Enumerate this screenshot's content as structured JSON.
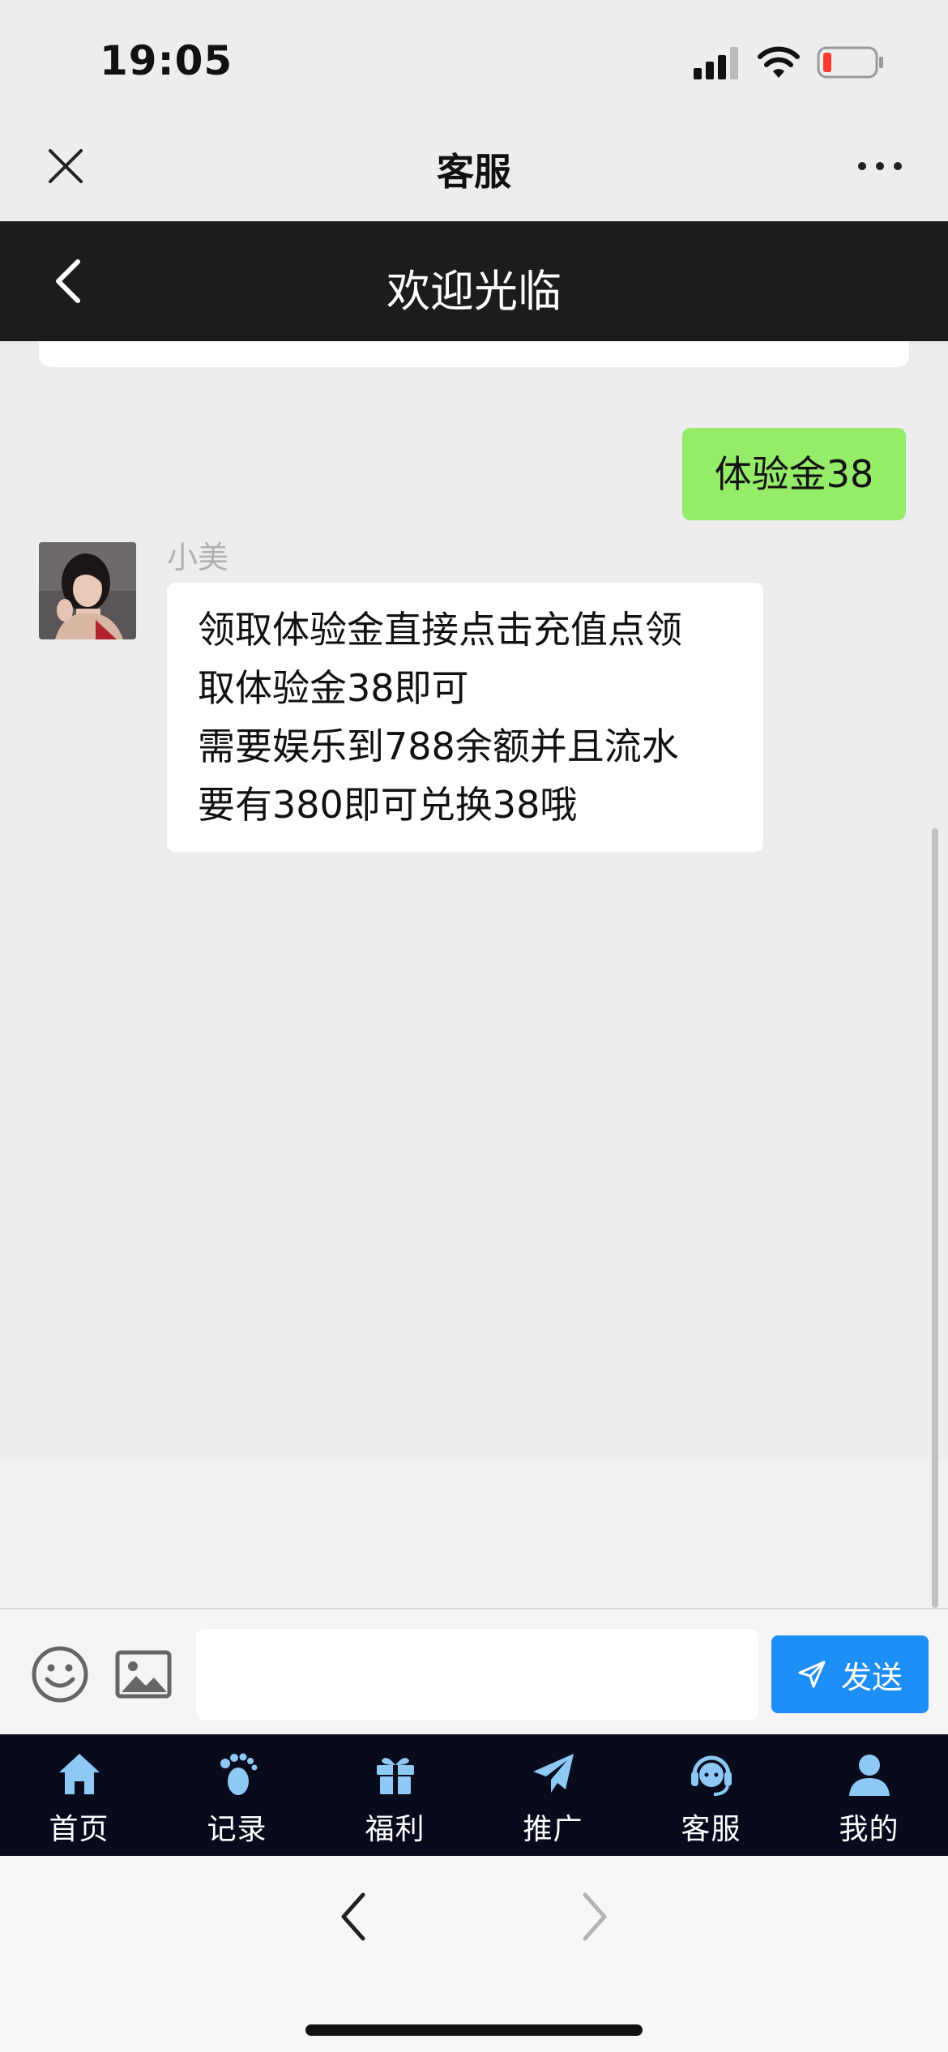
{
  "status": {
    "time": "19:05"
  },
  "miniprogram": {
    "title": "客服"
  },
  "nav": {
    "title": "欢迎光临"
  },
  "chat": {
    "outgoing": {
      "text": "体验金38",
      "color": "#95ec69"
    },
    "incoming": {
      "sender": "小美",
      "lines": [
        "领取体验金直接点击充值点领",
        "取体验金38即可",
        "需要娱乐到788余额并且流水",
        "要有380即可兑换38哦"
      ]
    }
  },
  "composer": {
    "value": "",
    "send_label": "发送",
    "send_color": "#1e8ef7",
    "icons": [
      "emoji-icon",
      "image-icon",
      "send-arrow-icon"
    ]
  },
  "tabs": [
    {
      "label": "首页",
      "icon": "home-icon"
    },
    {
      "label": "记录",
      "icon": "footprints-icon"
    },
    {
      "label": "福利",
      "icon": "gift-icon"
    },
    {
      "label": "推广",
      "icon": "paper-plane-icon"
    },
    {
      "label": "客服",
      "icon": "headset-icon"
    },
    {
      "label": "我的",
      "icon": "user-icon"
    }
  ],
  "tab_icon_color": "#8ec9f5",
  "tab_bar_color": "#070b1c"
}
